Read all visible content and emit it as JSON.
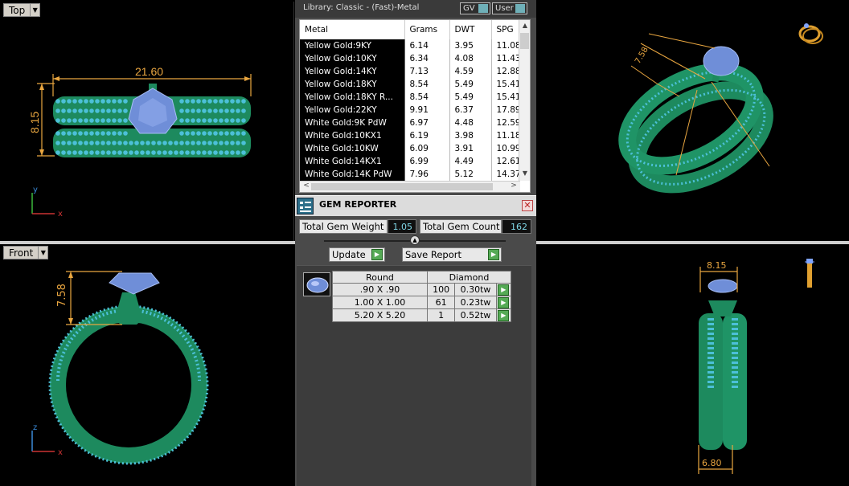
{
  "viewports": {
    "top": {
      "label": "Top",
      "dim_width": "21.60",
      "dim_height": "8.15",
      "axis_v": "y",
      "axis_h": "x"
    },
    "front": {
      "label": "Front",
      "dim_height": "7.58",
      "axis_v": "z",
      "axis_h": "x"
    },
    "right": {
      "dim_top": "8.15",
      "dim_bottom": "6.80"
    },
    "perspective": {
      "dim_a": "7.58"
    }
  },
  "library": {
    "title": "Library: Classic - (Fast)-Metal",
    "gv_label": "GV",
    "user_label": "User",
    "columns": [
      "Metal",
      "Grams",
      "DWT",
      "SPG"
    ],
    "rows": [
      {
        "metal": "Yellow Gold:9KY",
        "grams": "6.14",
        "dwt": "3.95",
        "spg": "11.08"
      },
      {
        "metal": "Yellow Gold:10KY",
        "grams": "6.34",
        "dwt": "4.08",
        "spg": "11.43"
      },
      {
        "metal": "Yellow Gold:14KY",
        "grams": "7.13",
        "dwt": "4.59",
        "spg": "12.88"
      },
      {
        "metal": "Yellow Gold:18KY",
        "grams": "8.54",
        "dwt": "5.49",
        "spg": "15.41"
      },
      {
        "metal": "Yellow Gold:18KY R...",
        "grams": "8.54",
        "dwt": "5.49",
        "spg": "15.41"
      },
      {
        "metal": "Yellow Gold:22KY",
        "grams": "9.91",
        "dwt": "6.37",
        "spg": "17.89"
      },
      {
        "metal": "White Gold:9K PdW",
        "grams": "6.97",
        "dwt": "4.48",
        "spg": "12.59"
      },
      {
        "metal": "White Gold:10KX1",
        "grams": "6.19",
        "dwt": "3.98",
        "spg": "11.18"
      },
      {
        "metal": "White Gold:10KW",
        "grams": "6.09",
        "dwt": "3.91",
        "spg": "10.99"
      },
      {
        "metal": "White Gold:14KX1",
        "grams": "6.99",
        "dwt": "4.49",
        "spg": "12.61"
      },
      {
        "metal": "White Gold:14K PdW",
        "grams": "7.96",
        "dwt": "5.12",
        "spg": "14.37"
      }
    ]
  },
  "gem_reporter": {
    "title": "GEM REPORTER",
    "total_weight_label": "Total Gem Weight",
    "total_weight_value": "1.05",
    "total_count_label": "Total Gem Count",
    "total_count_value": "162",
    "update_label": "Update",
    "save_report_label": "Save Report",
    "shape_header": "Round",
    "material_header": "Diamond",
    "gems": [
      {
        "size": ".90 X .90",
        "count": "100",
        "weight": "0.30tw"
      },
      {
        "size": "1.00 X 1.00",
        "count": "61",
        "weight": "0.23tw"
      },
      {
        "size": "5.20 X 5.20",
        "count": "1",
        "weight": "0.52tw"
      }
    ]
  },
  "colors": {
    "metal_green": "#1d8a5e",
    "bead_blue": "#49b8d4",
    "stone_blue": "#6f8ed8",
    "dimension_orange": "#e9a640",
    "viewport_bg": "#000000",
    "panel_bg": "#4a4a4a"
  }
}
